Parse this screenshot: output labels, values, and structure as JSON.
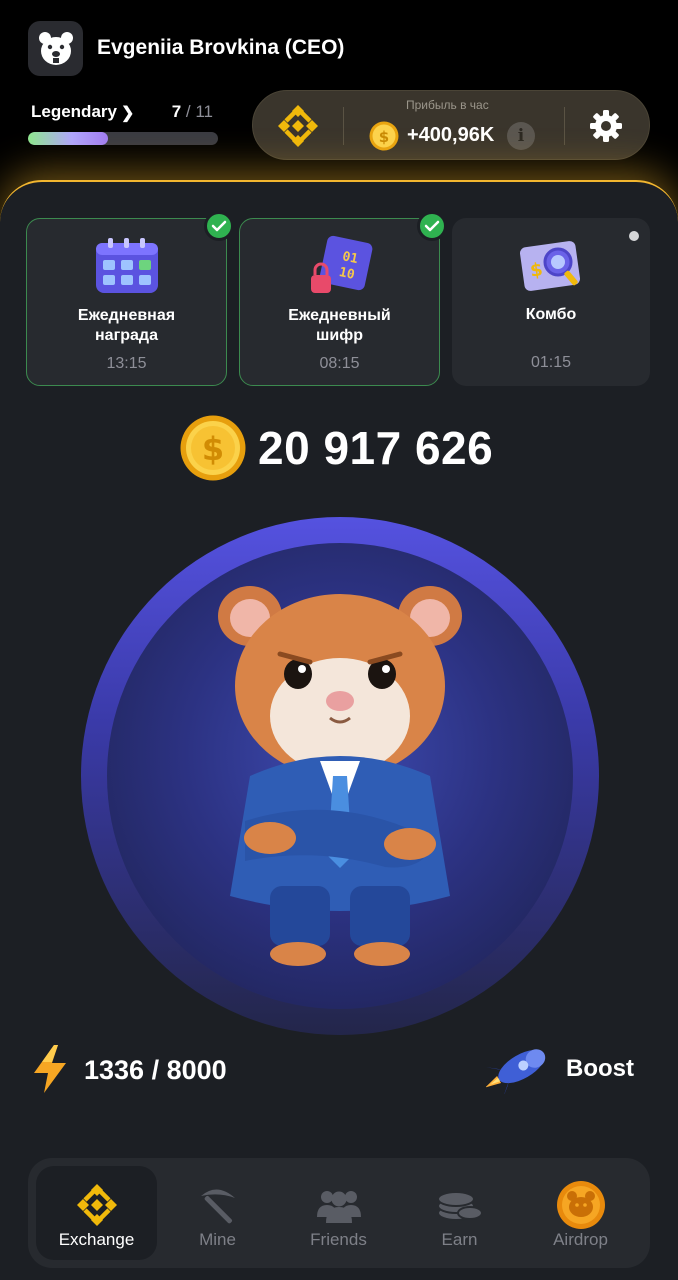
{
  "user": {
    "name": "Evgeniia Brovkina (CEO)"
  },
  "level": {
    "name": "Legendary",
    "current": "7",
    "total": "/ 11",
    "progress": 0.42
  },
  "profit": {
    "label": "Прибыль в час",
    "value": "+400,96K"
  },
  "tasks": [
    {
      "title_line1": "Ежедневная",
      "title_line2": "награда",
      "time": "13:15",
      "done": true
    },
    {
      "title_line1": "Ежедневный",
      "title_line2": "шифр",
      "time": "08:15",
      "done": true
    },
    {
      "title_line1": "Комбо",
      "title_line2": "",
      "time": "01:15",
      "done": false
    }
  ],
  "balance": {
    "value": "20 917 626"
  },
  "energy": {
    "value": "1336 / 8000"
  },
  "boost": {
    "label": "Boost"
  },
  "nav": [
    {
      "label": "Exchange",
      "icon": "binance-icon",
      "active": true
    },
    {
      "label": "Mine",
      "icon": "pickaxe-icon",
      "active": false
    },
    {
      "label": "Friends",
      "icon": "friends-icon",
      "active": false
    },
    {
      "label": "Earn",
      "icon": "coins-icon",
      "active": false
    },
    {
      "label": "Airdrop",
      "icon": "hamster-coin-icon",
      "active": false
    }
  ],
  "colors": {
    "accent": "#f2b62f",
    "success": "#2fb250",
    "card": "#272a2f",
    "background": "#1c1f24"
  }
}
